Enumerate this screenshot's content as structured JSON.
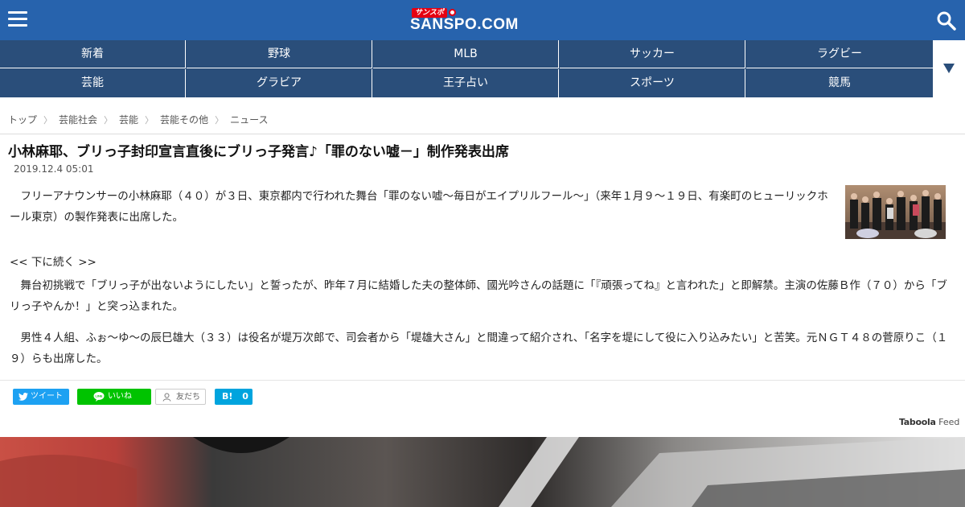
{
  "header": {
    "logo_badge": "サンスポ",
    "logo_text": "SANSPO.COM"
  },
  "nav": {
    "row1": [
      "新着",
      "野球",
      "MLB",
      "サッカー",
      "ラグビー"
    ],
    "row2": [
      "芸能",
      "グラビア",
      "王子占い",
      "スポーツ",
      "競馬"
    ]
  },
  "breadcrumb": [
    "トップ",
    "芸能社会",
    "芸能",
    "芸能その他",
    "ニュース"
  ],
  "article": {
    "title": "小林麻耶、ブリっ子封印宣言直後にブリっ子発言♪「罪のない嘘－」制作発表出席",
    "date": "2019.12.4 05:01",
    "p1": "　フリーアナウンサーの小林麻耶（４０）が３日、東京都内で行われた舞台「罪のない嘘～毎日がエイプリルフール～」（来年１月９～１９日、有楽町のヒューリックホール東京）の製作発表に出席した。",
    "continue": "<< 下に続く >>",
    "p2": "　舞台初挑戦で「ブリっ子が出ないようにしたい」と誓ったが、昨年７月に結婚した夫の整体師、國光吟さんの話題に「『頑張ってね』と言われた」と即解禁。主演の佐藤Ｂ作（７０）から「ブリっ子やんか！」と突っ込まれた。",
    "p3": "　男性４人組、ふぉ～ゆ～の辰巳雄大（３３）は役名が堤万次郎で、司会者から「堤雄大さん」と間違って紹介され、「名字を堤にして役に入り込みたい」と苦笑。元ＮＧＴ４８の菅原りこ（１９）らも出席した。"
  },
  "share": {
    "twitter": "ツイート",
    "line": "いいね",
    "friends": "友だち",
    "hatena_label": "B!",
    "hatena_count": "0"
  },
  "taboola": {
    "brand": "Taboola",
    "feed": "Feed"
  },
  "colors": {
    "header_bg": "#2763ad",
    "nav_bg": "#2a4e7a",
    "logo_accent": "#e60012",
    "twitter": "#1da1f2",
    "line": "#00c300",
    "hatena": "#00a4de"
  }
}
